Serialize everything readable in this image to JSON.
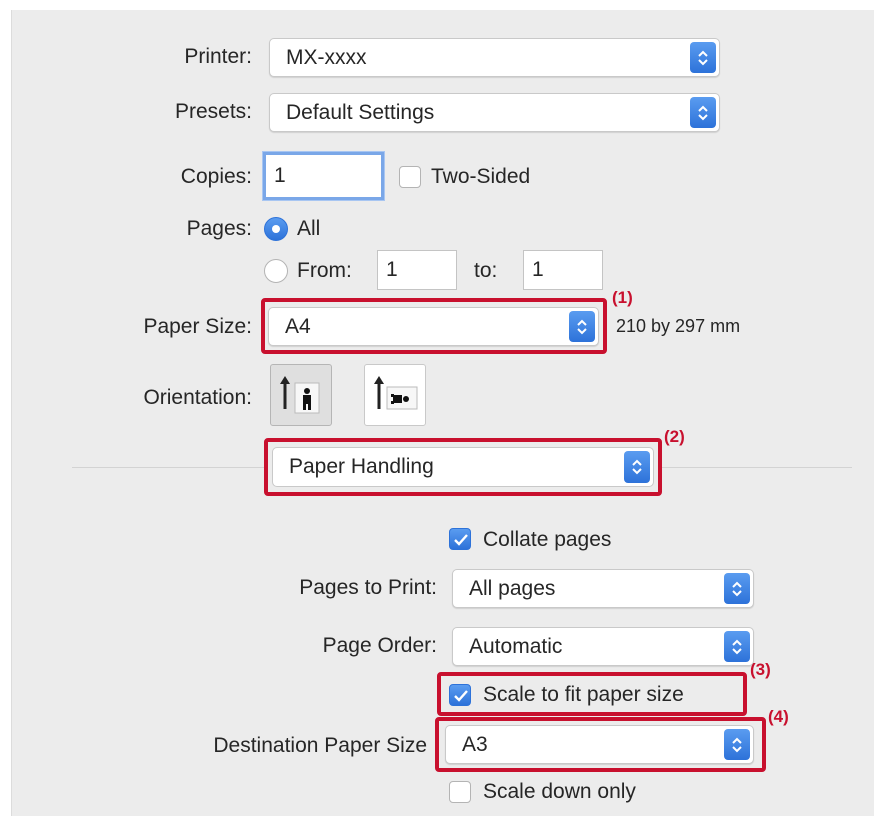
{
  "printer": {
    "label": "Printer:",
    "value": "MX-xxxx"
  },
  "presets": {
    "label": "Presets:",
    "value": "Default Settings"
  },
  "copies": {
    "label": "Copies:",
    "value": "1",
    "two_sided_label": "Two-Sided",
    "two_sided_checked": false
  },
  "pages": {
    "label": "Pages:",
    "all_label": "All",
    "from_label": "From:",
    "from_value": "1",
    "to_label": "to:",
    "to_value": "1",
    "selected": "all"
  },
  "paper_size": {
    "label": "Paper Size:",
    "value": "A4",
    "dimensions": "210 by 297 mm"
  },
  "orientation": {
    "label": "Orientation:",
    "options": [
      "portrait-icon",
      "landscape-icon"
    ],
    "selected": "portrait"
  },
  "section_menu": {
    "value": "Paper Handling"
  },
  "paper_handling": {
    "collate_label": "Collate pages",
    "collate_checked": true,
    "pages_to_print_label": "Pages to Print:",
    "pages_to_print_value": "All pages",
    "page_order_label": "Page Order:",
    "page_order_value": "Automatic",
    "scale_to_fit_label": "Scale to fit paper size",
    "scale_to_fit_checked": true,
    "destination_label": "Destination Paper Size",
    "destination_value": "A3",
    "scale_down_label": "Scale down only",
    "scale_down_checked": false
  },
  "callouts": [
    "(1)",
    "(2)",
    "(3)",
    "(4)"
  ],
  "colors": {
    "accent": "#2d72d9",
    "highlight": "#c8102e",
    "panel_bg": "#ececec"
  }
}
